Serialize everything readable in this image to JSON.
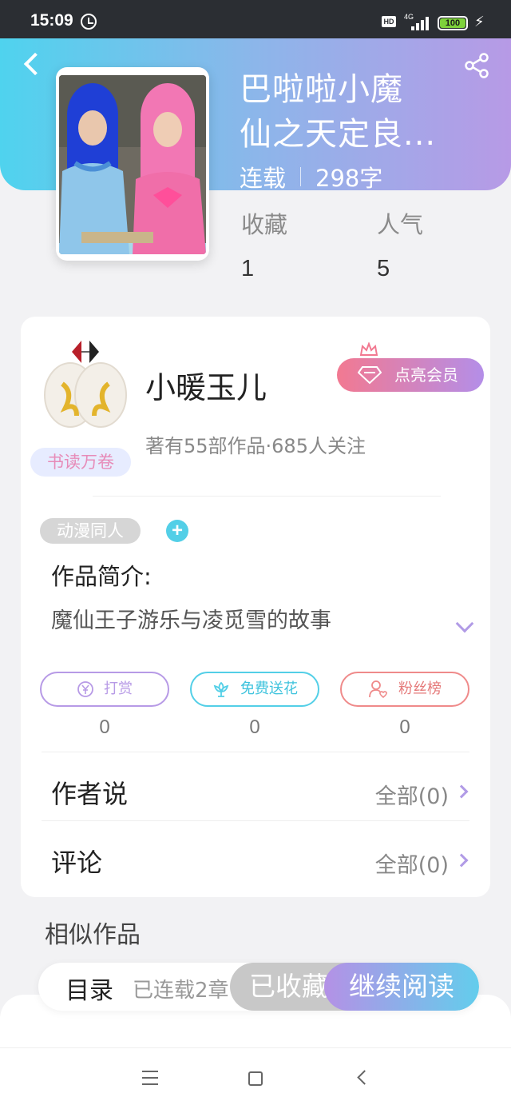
{
  "status_bar": {
    "time": "15:09",
    "hd": "HD",
    "network": "4G",
    "battery": "100"
  },
  "book": {
    "title_line1": "巴啦啦小魔",
    "title_line2": "仙之天定良...",
    "status": "连载",
    "word_count": "298字"
  },
  "stats": {
    "favorites_label": "收藏",
    "favorites_value": "1",
    "popularity_label": "人气",
    "popularity_value": "5"
  },
  "author": {
    "name": "小暖玉儿",
    "badge": "书读万卷",
    "meta": "著有55部作品·685人关注",
    "vip_button": "点亮会员"
  },
  "tag": "动漫同人",
  "intro": {
    "heading": "作品简介:",
    "text": "魔仙王子游乐与凌觅雪的故事"
  },
  "actions": [
    {
      "label": "打赏",
      "count": "0",
      "color": "#b79ae6"
    },
    {
      "label": "免费送花",
      "count": "0",
      "color": "#53cfe7"
    },
    {
      "label": "粉丝榜",
      "count": "0",
      "color": "#ef8a8a"
    }
  ],
  "rows": [
    {
      "label": "作者说",
      "value": "全部(0)"
    },
    {
      "label": "评论",
      "value": "全部(0)"
    }
  ],
  "similar_title": "相似作品",
  "bottom": {
    "toc": "目录",
    "toc_count": "已连载2章",
    "collected": "已收藏",
    "continue": "继续阅读"
  },
  "colors": {
    "accent_cyan": "#4fd3ee",
    "accent_purple": "#b79ae6",
    "vip_pink": "#f27991"
  }
}
